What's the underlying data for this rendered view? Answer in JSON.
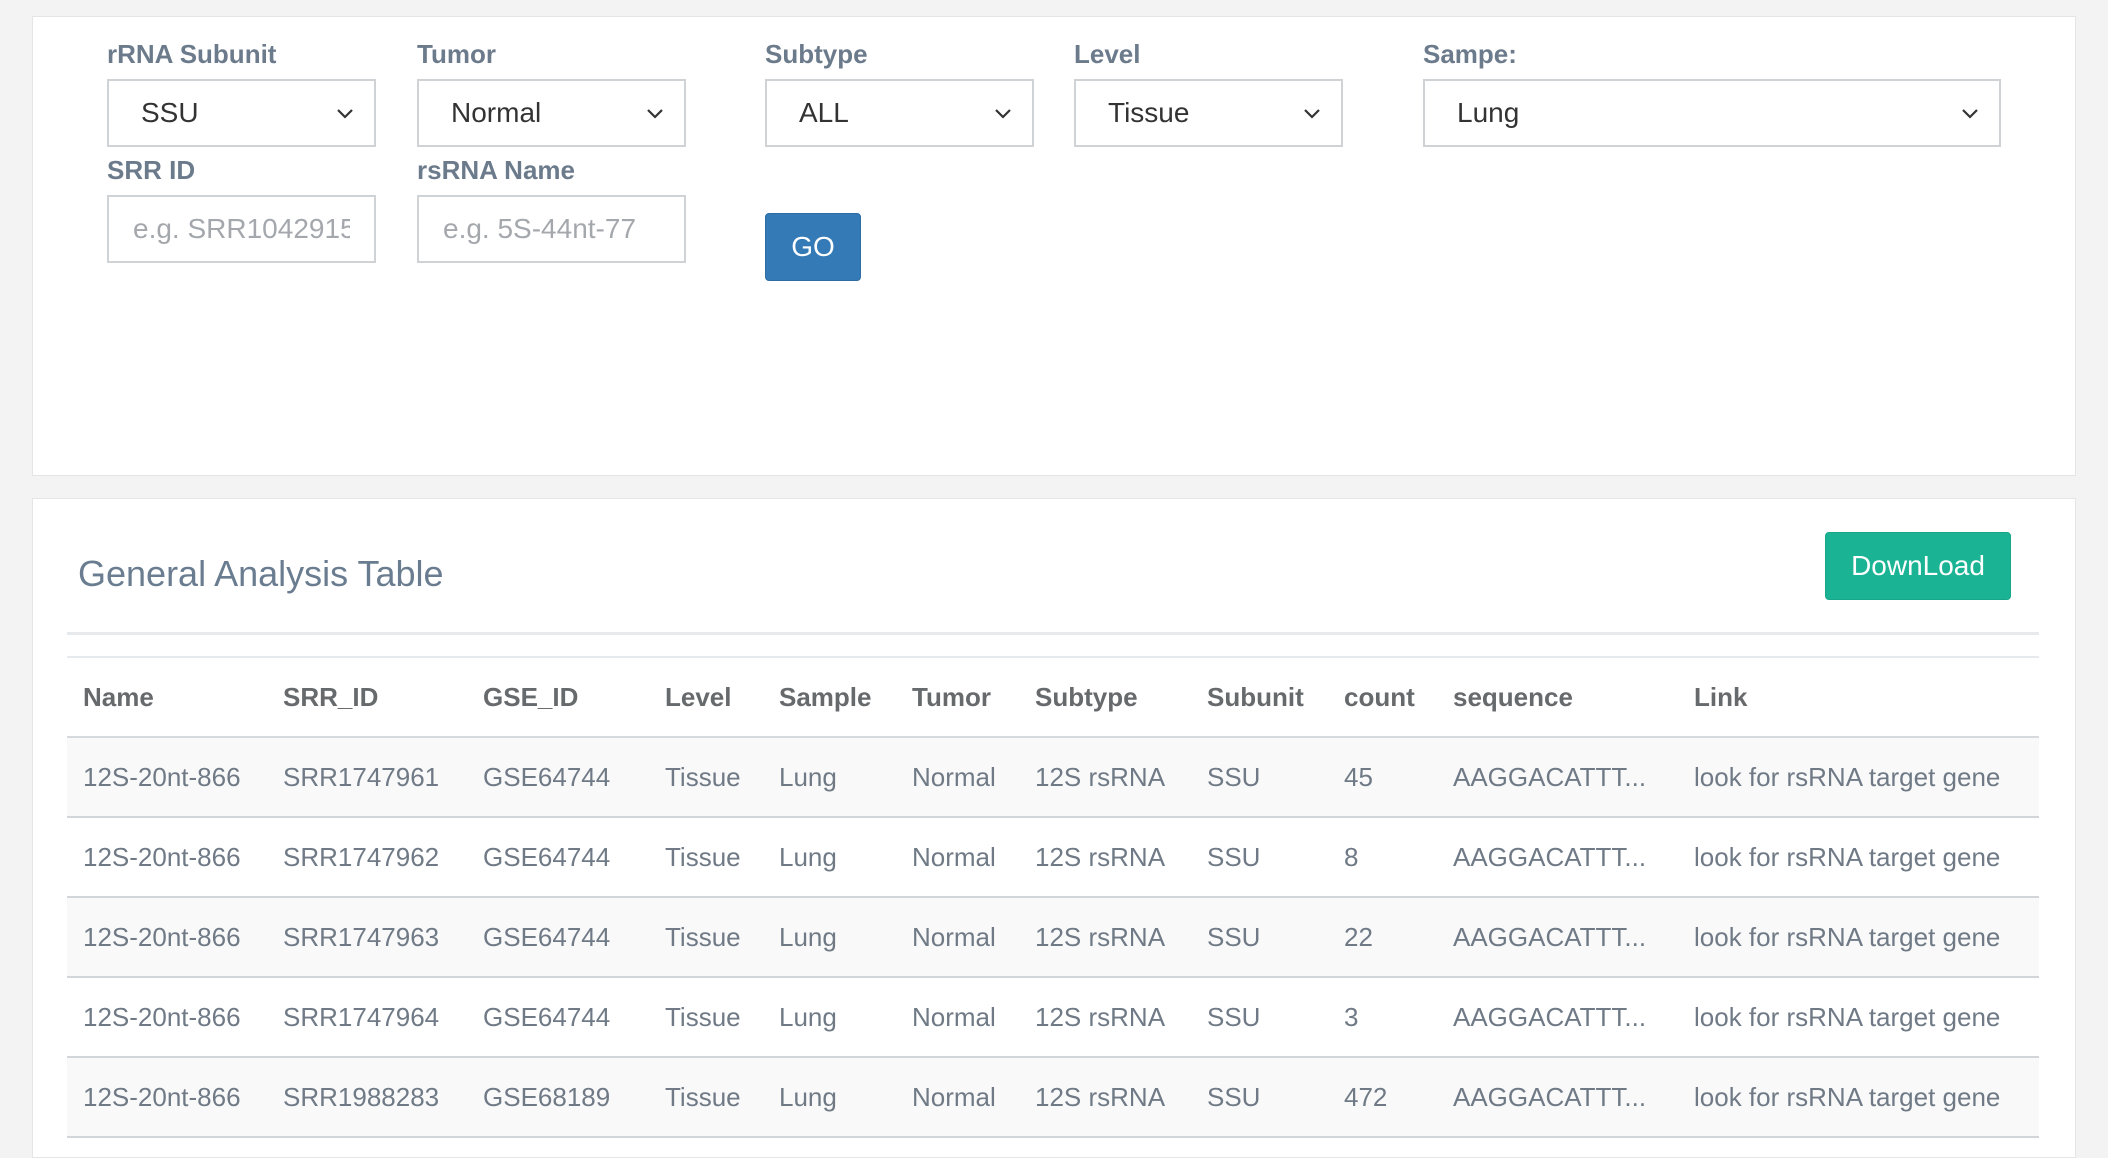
{
  "filters": {
    "rrna_subunit": {
      "label": "rRNA Subunit",
      "value": "SSU"
    },
    "tumor": {
      "label": "Tumor",
      "value": "Normal"
    },
    "subtype": {
      "label": "Subtype",
      "value": "ALL"
    },
    "level": {
      "label": "Level",
      "value": "Tissue"
    },
    "sample": {
      "label": "Sampe:",
      "value": "Lung"
    },
    "srr_id": {
      "label": "SRR ID",
      "placeholder": "e.g. SRR1042915",
      "value": ""
    },
    "rsrna_name": {
      "label": "rsRNA Name",
      "placeholder": "e.g. 5S-44nt-77",
      "value": ""
    },
    "go_label": "GO"
  },
  "table": {
    "title": "General Analysis Table",
    "download_label": "DownLoad",
    "columns": [
      "Name",
      "SRR_ID",
      "GSE_ID",
      "Level",
      "Sample",
      "Tumor",
      "Subtype",
      "Subunit",
      "count",
      "sequence",
      "Link"
    ],
    "rows": [
      [
        "12S-20nt-866",
        "SRR1747961",
        "GSE64744",
        "Tissue",
        "Lung",
        "Normal",
        "12S rsRNA",
        "SSU",
        "45",
        "AAGGACATTT...",
        "look for rsRNA target gene"
      ],
      [
        "12S-20nt-866",
        "SRR1747962",
        "GSE64744",
        "Tissue",
        "Lung",
        "Normal",
        "12S rsRNA",
        "SSU",
        "8",
        "AAGGACATTT...",
        "look for rsRNA target gene"
      ],
      [
        "12S-20nt-866",
        "SRR1747963",
        "GSE64744",
        "Tissue",
        "Lung",
        "Normal",
        "12S rsRNA",
        "SSU",
        "22",
        "AAGGACATTT...",
        "look for rsRNA target gene"
      ],
      [
        "12S-20nt-866",
        "SRR1747964",
        "GSE64744",
        "Tissue",
        "Lung",
        "Normal",
        "12S rsRNA",
        "SSU",
        "3",
        "AAGGACATTT...",
        "look for rsRNA target gene"
      ],
      [
        "12S-20nt-866",
        "SRR1988283",
        "GSE68189",
        "Tissue",
        "Lung",
        "Normal",
        "12S rsRNA",
        "SSU",
        "472",
        "AAGGACATTT...",
        "look for rsRNA target gene"
      ]
    ]
  }
}
